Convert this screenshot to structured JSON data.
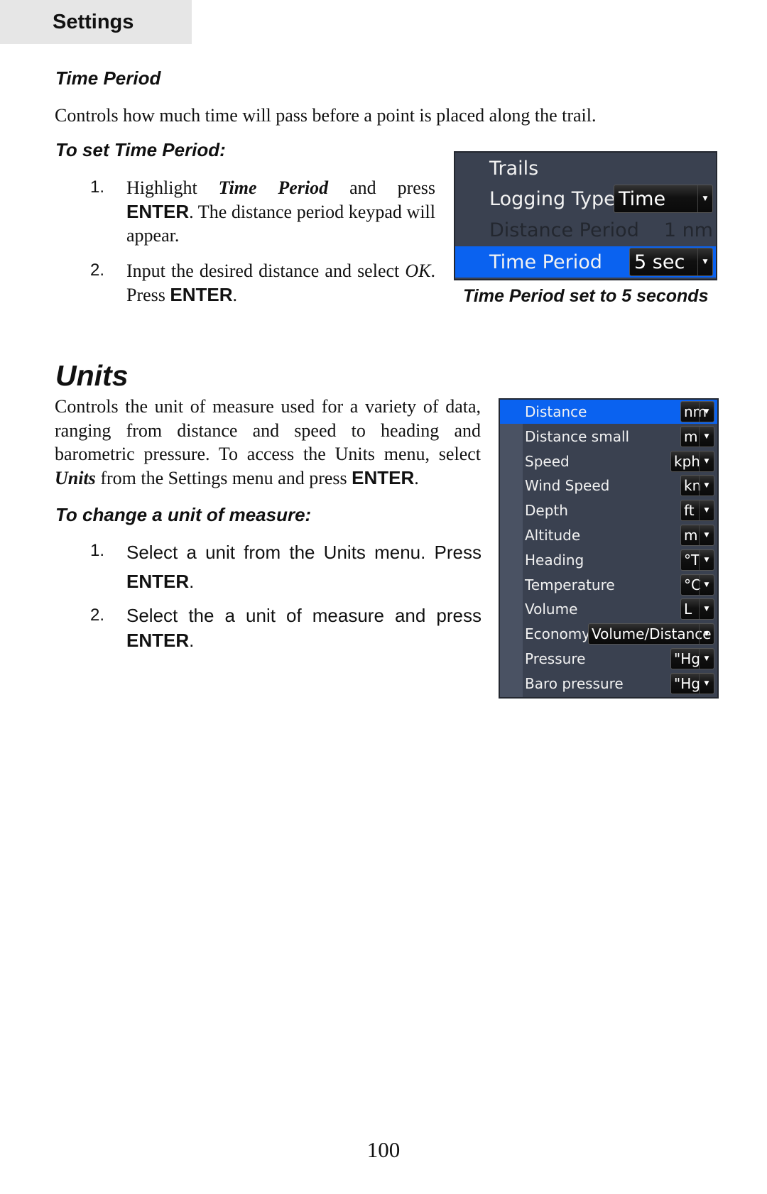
{
  "header": {
    "section": "Settings"
  },
  "time_period": {
    "heading": "Time Period",
    "description": "Controls how much time will pass before a point is placed along the trail.",
    "subheading": "To set Time Period:",
    "steps": [
      {
        "num": "1.",
        "pre": "Highlight",
        "em": "Time Period",
        "mid": "and press",
        "key": "ENTER",
        "post": ". The distance period keypad will appear."
      },
      {
        "num": "2.",
        "pre": "Input the desired distance and select",
        "em": "OK",
        "mid": ". Press",
        "key": "ENTER",
        "post": "."
      }
    ],
    "screen": {
      "title": "Trails",
      "rows": [
        {
          "label": "Logging Type",
          "value": "Time",
          "type": "dropdown"
        },
        {
          "label": "Distance Period",
          "value": "1 nm",
          "type": "disabled"
        },
        {
          "label": "Time Period",
          "value": "5 sec",
          "type": "dropdown",
          "selected": true
        }
      ]
    },
    "caption": "Time Period set to 5 seconds"
  },
  "units": {
    "heading": "Units",
    "description_pre": "Controls the unit of measure used for a variety of data, ranging from distance and speed to heading and barometric pressure. To access the Units menu, select",
    "description_em": "Units",
    "description_mid": "from the Settings menu and press",
    "description_key": "ENTER",
    "description_post": ".",
    "subheading": "To change a unit of measure:",
    "steps": [
      {
        "num": "1.",
        "text": "Select a unit from the Units menu. Press",
        "key": "ENTER",
        "post": "."
      },
      {
        "num": "2.",
        "text": "Select the a unit of measure and press",
        "key": "ENTER",
        "post": "."
      }
    ],
    "menu": [
      {
        "label": "Distance",
        "value": "nm",
        "selected": true
      },
      {
        "label": "Distance small",
        "value": "m"
      },
      {
        "label": "Speed",
        "value": "kph"
      },
      {
        "label": "Wind Speed",
        "value": "kn"
      },
      {
        "label": "Depth",
        "value": "ft"
      },
      {
        "label": "Altitude",
        "value": "m"
      },
      {
        "label": "Heading",
        "value": "°T"
      },
      {
        "label": "Temperature",
        "value": "°C"
      },
      {
        "label": "Volume",
        "value": "L"
      },
      {
        "label": "Economy",
        "value": "Volume/Distance"
      },
      {
        "label": "Pressure",
        "value": "\"Hg"
      },
      {
        "label": "Baro pressure",
        "value": "\"Hg"
      }
    ]
  },
  "footer": {
    "page_number": "100"
  },
  "icons": {
    "dropdown": "chevron-down-icon"
  },
  "colors": {
    "highlight": "#0a62f0",
    "panel": "#3a4150"
  }
}
